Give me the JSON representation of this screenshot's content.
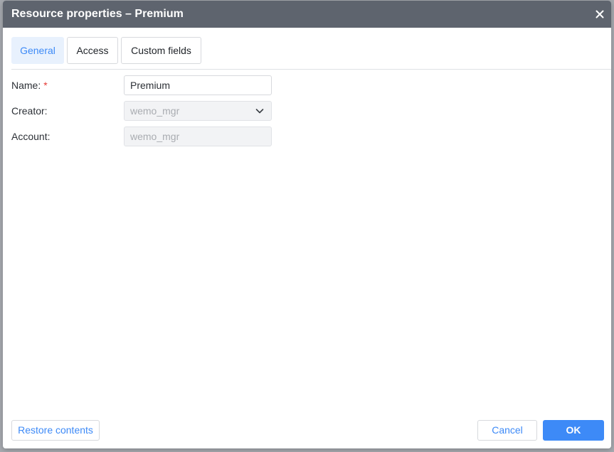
{
  "dialog": {
    "title": "Resource properties – Premium",
    "close_icon": "close-icon"
  },
  "tabs": [
    {
      "label": "General",
      "active": true
    },
    {
      "label": "Access",
      "active": false
    },
    {
      "label": "Custom fields",
      "active": false
    }
  ],
  "form": {
    "name": {
      "label": "Name:",
      "required_mark": "*",
      "value": "Premium"
    },
    "creator": {
      "label": "Creator:",
      "value": "wemo_mgr",
      "icon": "chevron-down-icon"
    },
    "account": {
      "label": "Account:",
      "value": "wemo_mgr"
    }
  },
  "buttons": {
    "restore": "Restore contents",
    "cancel": "Cancel",
    "ok": "OK"
  },
  "colors": {
    "titlebar": "#5e646e",
    "accent": "#3d8af7",
    "active_tab_bg": "#e8f1fd",
    "required": "#e53935"
  }
}
